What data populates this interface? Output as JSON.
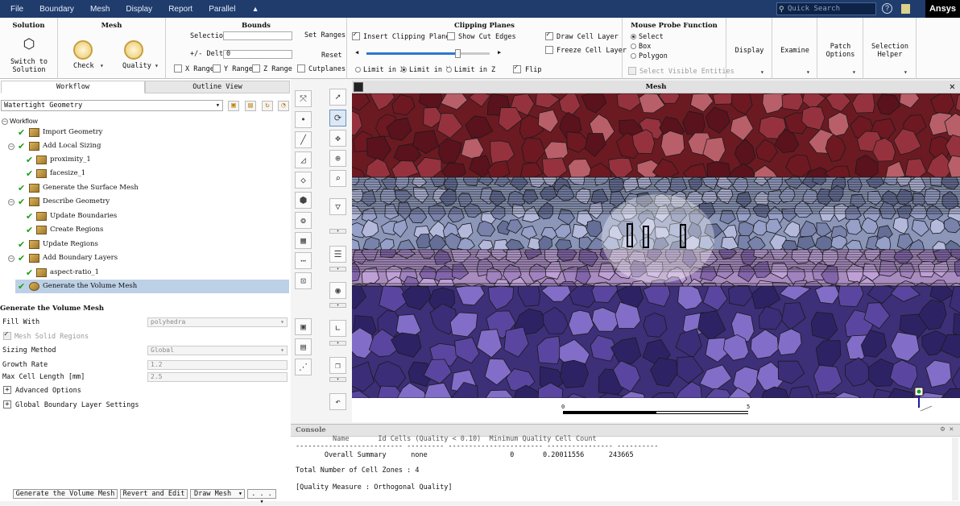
{
  "menu": [
    "File",
    "Boundary",
    "Mesh",
    "Display",
    "Report",
    "Parallel"
  ],
  "quick_search": "Quick Search",
  "brand": "Ansys",
  "ribbon": {
    "solution": {
      "title": "Solution",
      "switch_label_1": "Switch to",
      "switch_label_2": "Solution"
    },
    "mesh": {
      "title": "Mesh",
      "check": "Check",
      "quality": "Quality"
    },
    "bounds": {
      "title": "Bounds",
      "selection": "Selection",
      "delta": "+/- Delta",
      "delta_value": "0",
      "set_ranges": "Set Ranges",
      "reset": "Reset",
      "x_range": "X Range",
      "y_range": "Y Range",
      "z_range": "Z Range",
      "cutplanes": "Cutplanes"
    },
    "clipping": {
      "title": "Clipping Planes",
      "insert": "Insert Clipping Planes",
      "show_cut": "Show Cut Edges",
      "draw_cell": "Draw Cell Layer",
      "freeze": "Freeze Cell Layer",
      "limit_x": "Limit in X",
      "limit_y": "Limit in Y",
      "limit_z": "Limit in Z",
      "flip": "Flip",
      "slider_fraction": 0.74
    },
    "probe": {
      "title": "Mouse Probe Function",
      "select": "Select",
      "box": "Box",
      "polygon": "Polygon",
      "visible": "Select Visible Entities"
    },
    "display": "Display",
    "examine": "Examine",
    "patch_1": "Patch",
    "patch_2": "Options",
    "sel_1": "Selection",
    "sel_2": "Helper"
  },
  "left": {
    "tab_workflow": "Workflow",
    "tab_outline": "Outline View",
    "workflow_type": "Watertight Geometry",
    "tree": [
      {
        "label": "Workflow"
      },
      {
        "label": "Import Geometry"
      },
      {
        "label": "Add Local Sizing"
      },
      {
        "label": "proximity_1"
      },
      {
        "label": "facesize_1"
      },
      {
        "label": "Generate the Surface Mesh"
      },
      {
        "label": "Describe Geometry"
      },
      {
        "label": "Update Boundaries"
      },
      {
        "label": "Create Regions"
      },
      {
        "label": "Update Regions"
      },
      {
        "label": "Add Boundary Layers"
      },
      {
        "label": "aspect-ratio_1"
      },
      {
        "label": "Generate the Volume Mesh"
      }
    ],
    "props": {
      "heading": "Generate the Volume Mesh",
      "fill_with": "Fill With",
      "fill_with_value": "polyhedra",
      "mesh_solid": "Mesh Solid Regions",
      "sizing_method": "Sizing Method",
      "sizing_method_value": "Global",
      "growth_rate": "Growth Rate",
      "growth_rate_value": "1.2",
      "max_cell": "Max Cell Length [mm]",
      "max_cell_value": "2.5",
      "advanced": "Advanced Options",
      "global_bl": "Global Boundary Layer Settings"
    },
    "buttons": {
      "generate": "Generate the Volume Mesh",
      "revert": "Revert and Edit",
      "draw": "Draw Mesh",
      "more": ". . ."
    }
  },
  "graphics": {
    "title": "Mesh",
    "scale_min": "0",
    "scale_max": "5"
  },
  "console": {
    "title": "Console",
    "header": "         Name       Id Cells (Quality < 0.10)  Minimum Quality Cell Count",
    "sep": "-------------------------- --------- ----------------------- ---------------- ----------",
    "summary": "       Overall Summary      none                    0       0.20011556      243665",
    "zones": "Total Number of Cell Zones : 4",
    "measure": "[Quality Measure : Orthogonal Quality]"
  },
  "colors": {
    "menubar": "#1f3c6d",
    "band_top": "#6b1a22",
    "band_mid": "#8b96b8",
    "band_low": "#a88bbf",
    "band_bottom": "#3d2f78",
    "selected": "#bdd1e6"
  }
}
